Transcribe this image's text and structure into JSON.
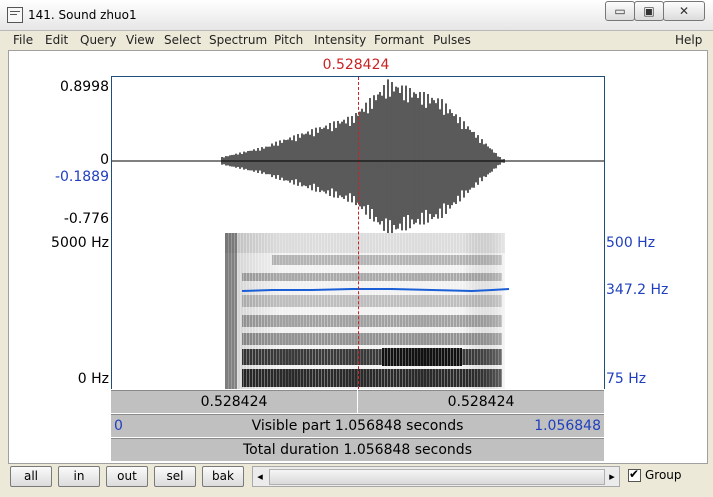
{
  "window": {
    "title": "141. Sound zhuo1",
    "minimize": "▭",
    "maximize": "▣",
    "close": "✕"
  },
  "menu": [
    "File",
    "Edit",
    "Query",
    "View",
    "Select",
    "Spectrum",
    "Pitch",
    "Intensity",
    "Formant",
    "Pulses",
    "Help"
  ],
  "cursor_time": "0.528424",
  "waveform": {
    "y_top": "0.8998",
    "y_zero": "0",
    "y_cursor": "-0.1889",
    "y_bottom": "-0.776"
  },
  "spectrogram": {
    "freq_top": "5000 Hz",
    "freq_bottom": "0 Hz",
    "pitch_top": "500 Hz",
    "pitch_cursor": "347.2 Hz",
    "pitch_bottom": "75 Hz"
  },
  "bars": {
    "left_selection": "0.528424",
    "right_selection": "0.528424",
    "visible_start": "0",
    "visible_part": "Visible part 1.056848 seconds",
    "visible_end": "1.056848",
    "total_duration": "Total duration 1.056848 seconds"
  },
  "buttons": {
    "all": "all",
    "in": "in",
    "out": "out",
    "sel": "sel",
    "bak": "bak"
  },
  "scroll": {
    "left": "◂",
    "right": "▸"
  },
  "group": {
    "label": "Group",
    "checked": true,
    "mark": "✔"
  },
  "colors": {
    "cursor": "#cc2222",
    "pitch": "#1a5fd6",
    "pitch_text": "#1f3fbf",
    "accent_border": "#1f4e79"
  }
}
